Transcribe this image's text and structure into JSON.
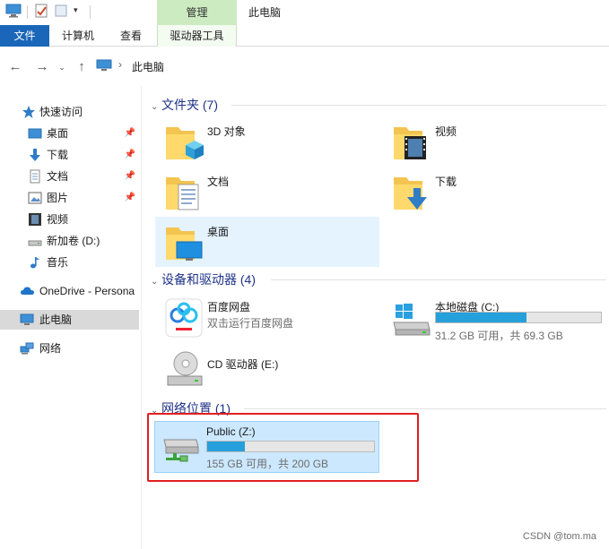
{
  "titlebar": {
    "manage_tab": "管理",
    "window_title": "此电脑"
  },
  "ribbon": {
    "tabs": [
      "文件",
      "计算机",
      "查看",
      "驱动器工具"
    ]
  },
  "address": {
    "location": "此电脑"
  },
  "nav": {
    "quick_access": "快速访问",
    "items": [
      {
        "label": "桌面",
        "pinned": true
      },
      {
        "label": "下载",
        "pinned": true
      },
      {
        "label": "文档",
        "pinned": true
      },
      {
        "label": "图片",
        "pinned": true
      },
      {
        "label": "视频",
        "pinned": false
      },
      {
        "label": "新加卷 (D:)",
        "pinned": false
      },
      {
        "label": "音乐",
        "pinned": false
      }
    ],
    "onedrive": "OneDrive - Persona",
    "this_pc": "此电脑",
    "network": "网络"
  },
  "groups": {
    "folders": {
      "title": "文件夹 (7)",
      "items": [
        "3D 对象",
        "视频",
        "文档",
        "下载",
        "桌面"
      ]
    },
    "devices": {
      "title": "设备和驱动器 (4)",
      "baidu": {
        "name": "百度网盘",
        "sub": "双击运行百度网盘"
      },
      "local_c": {
        "name": "本地磁盘 (C:)",
        "sub": "31.2 GB 可用，共 69.3 GB",
        "used_fraction": 0.55
      },
      "cd": {
        "name": "CD 驱动器 (E:)"
      }
    },
    "network": {
      "title": "网络位置 (1)",
      "public_z": {
        "name": "Public (Z:)",
        "sub": "155 GB 可用，共 200 GB",
        "used_fraction": 0.225
      }
    }
  },
  "watermark": "CSDN @tom.ma",
  "colors": {
    "accent": "#1a66b8",
    "manage_tab": "#cdebc1",
    "progress": "#26a0da",
    "highlight_box": "#e21f1f",
    "group_header": "#1e3287"
  }
}
